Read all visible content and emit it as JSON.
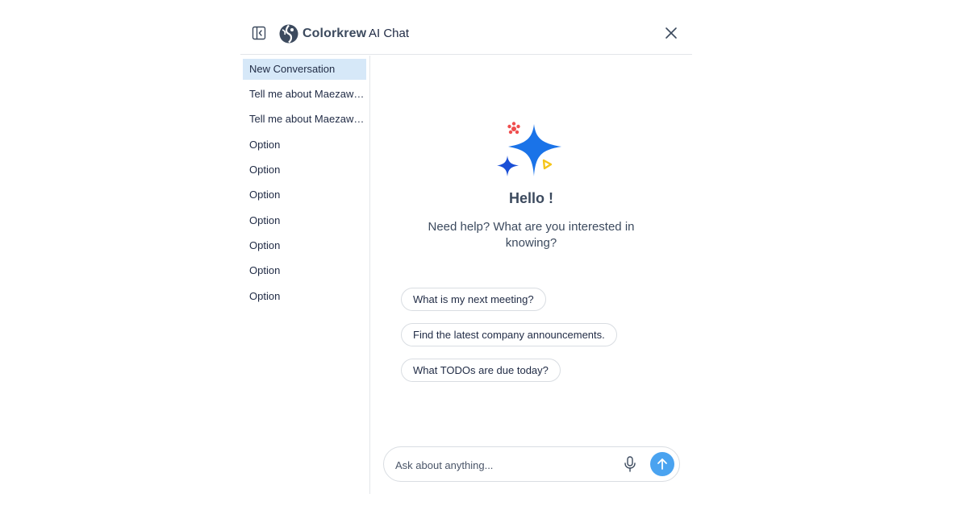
{
  "header": {
    "brand_name": "Colorkrew",
    "title": "AI Chat",
    "icons": {
      "sidebar_toggle": "sidebar-collapse-icon",
      "close": "close-icon",
      "logo": "colorkrew-logo-icon"
    }
  },
  "sidebar": {
    "items": [
      {
        "label": "New Conversation",
        "active": true
      },
      {
        "label": "Tell me about Maezawa's Blog",
        "active": false
      },
      {
        "label": "Tell me about Maezawa's Blog",
        "active": false
      },
      {
        "label": "Option",
        "active": false
      },
      {
        "label": "Option",
        "active": false
      },
      {
        "label": "Option",
        "active": false
      },
      {
        "label": "Option",
        "active": false
      },
      {
        "label": "Option",
        "active": false
      },
      {
        "label": "Option",
        "active": false
      },
      {
        "label": "Option",
        "active": false
      }
    ]
  },
  "main": {
    "hero_icon": "sparkle-icon",
    "greeting": "Hello !",
    "subtitle": "Need help? What are you interested in knowing?",
    "suggestions": [
      "What is my next meeting?",
      "Find the latest company announcements.",
      "What TODOs are due today?"
    ]
  },
  "composer": {
    "placeholder": "Ask about anything...",
    "value": "",
    "mic_icon": "microphone-icon",
    "send_icon": "arrow-up-icon"
  },
  "colors": {
    "accent": "#4aa3f0",
    "active_item_bg": "#d6e8f8",
    "sparkle_blue": "#1a73e8",
    "sparkle_red": "#ef4e4e",
    "sparkle_yellow": "#f5c518",
    "text": "#1f2a44"
  }
}
